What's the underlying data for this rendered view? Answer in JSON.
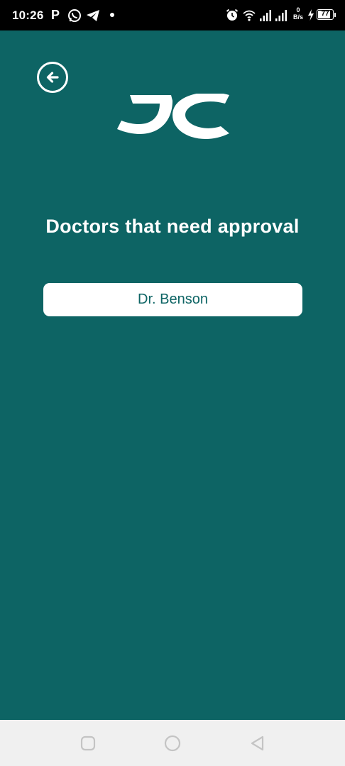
{
  "status_bar": {
    "time": "10:26",
    "p_indicator": "P",
    "net_speed_value": "0",
    "net_speed_unit": "B/s",
    "battery_level": "77",
    "battery_fraction": 0.77
  },
  "icons": {
    "back": "arrow-left-circle-icon",
    "logo": "jc-logo",
    "whatsapp": "whatsapp-icon",
    "telegram": "telegram-icon",
    "alarm": "alarm-icon",
    "wifi": "wifi-icon",
    "signal": "signal-icon",
    "charging": "charging-icon",
    "nav_recent": "square-icon",
    "nav_home": "circle-icon",
    "nav_back": "triangle-back-icon"
  },
  "colors": {
    "background": "#0d6464",
    "card": "#ffffff",
    "card_text": "#0d6464",
    "nav_bar": "#f0f0f0"
  },
  "main": {
    "title": "Doctors that need approval",
    "doctors": [
      {
        "name": "Dr. Benson"
      }
    ]
  }
}
